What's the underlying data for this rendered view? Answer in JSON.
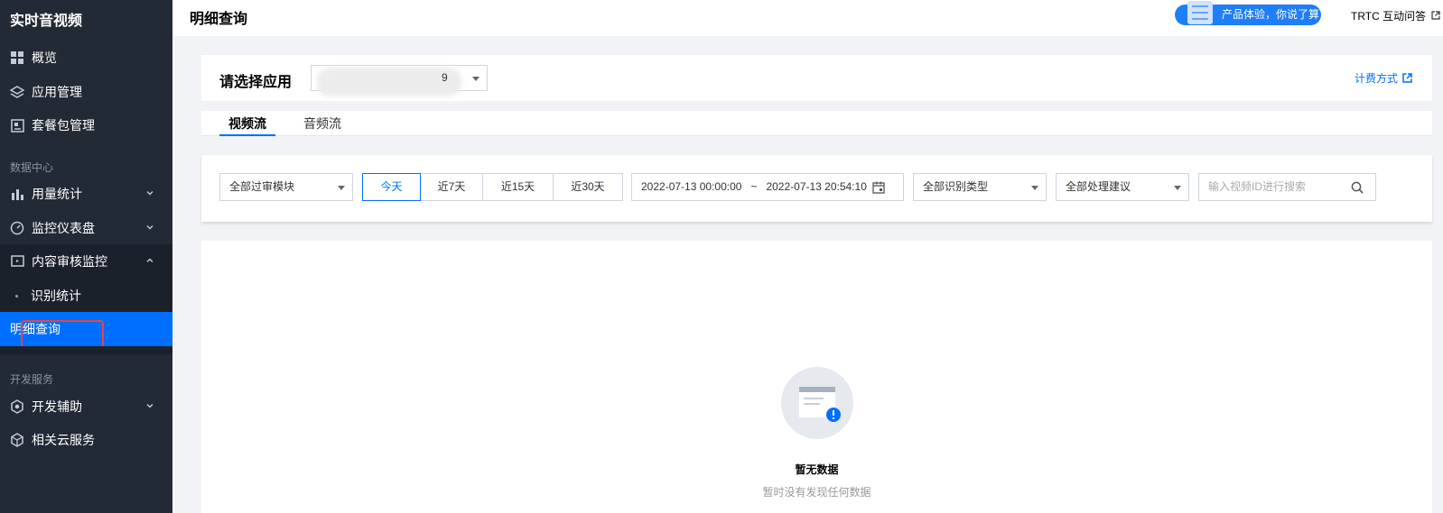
{
  "sidebar": {
    "brand": "实时音视频",
    "items": [
      {
        "label": "概览"
      },
      {
        "label": "应用管理"
      },
      {
        "label": "套餐包管理"
      }
    ],
    "section_data": "数据中心",
    "data_items": [
      {
        "label": "用量统计"
      },
      {
        "label": "监控仪表盘"
      },
      {
        "label": "内容审核监控"
      },
      {
        "label": "识别统计"
      },
      {
        "label": "明细查询"
      }
    ],
    "section_dev": "开发服务",
    "dev_items": [
      {
        "label": "开发辅助"
      },
      {
        "label": "相关云服务"
      }
    ]
  },
  "header": {
    "title": "明细查询",
    "feedback": "产品体验，你说了算",
    "help": "TRTC 互动问答"
  },
  "app_selector": {
    "label": "请选择应用",
    "value_suffix": "9",
    "billing": "计费方式"
  },
  "tabs": [
    {
      "label": "视频流",
      "active": true
    },
    {
      "label": "音频流",
      "active": false
    }
  ],
  "filters": {
    "module": "全部过审模块",
    "ranges": [
      "今天",
      "近7天",
      "近15天",
      "近30天"
    ],
    "date_start": "2022-07-13 00:00:00",
    "date_sep": "~",
    "date_end": "2022-07-13 20:54:10",
    "recog_type": "全部识别类型",
    "suggestion": "全部处理建议",
    "search_placeholder": "输入视频ID进行搜索"
  },
  "empty": {
    "title": "暂无数据",
    "desc": "暂时没有发现任何数据"
  },
  "colors": {
    "sidebar_bg": "#222a35",
    "accent": "#006eff",
    "highlight": "#e64545"
  }
}
